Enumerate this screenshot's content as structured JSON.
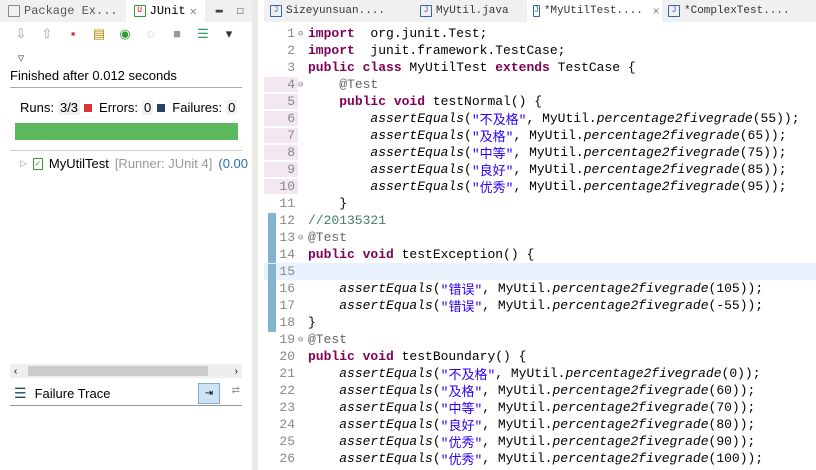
{
  "left": {
    "tabs": [
      {
        "label": "Package Ex..."
      },
      {
        "label": "JUnit"
      }
    ],
    "status": "Finished after 0.012 seconds",
    "runs_label": "Runs:",
    "runs": "3/3",
    "errors_label": "Errors:",
    "errors": "0",
    "failures_label": "Failures:",
    "failures": "0",
    "progress": 1.0,
    "progress_color": "#5cb85c",
    "tree_item": {
      "name": "MyUtilTest",
      "runner": "[Runner: JUnit 4]",
      "time": "(0.00"
    },
    "failure_trace": "Failure Trace"
  },
  "editor": {
    "tabs": [
      {
        "label": "Sizeyunsuan...."
      },
      {
        "label": "MyUtil.java"
      },
      {
        "label": "*MyUtilTest...."
      },
      {
        "label": "*ComplexTest...."
      }
    ],
    "lines": [
      {
        "n": "1",
        "fold": "⊖",
        "t": [
          [
            "kw",
            "import"
          ],
          [
            "",
            "  org.junit.Test;"
          ]
        ]
      },
      {
        "n": "2",
        "t": [
          [
            "kw",
            "import"
          ],
          [
            "",
            "  junit.framework.TestCase;"
          ]
        ]
      },
      {
        "n": "3",
        "t": [
          [
            "kw",
            "public class"
          ],
          [
            "",
            " MyUtilTest "
          ],
          [
            "kw",
            "extends"
          ],
          [
            "",
            " TestCase {"
          ]
        ]
      },
      {
        "n": "4",
        "fold": "⊖",
        "g": "pink",
        "t": [
          [
            "",
            "    "
          ],
          [
            "ann",
            "@Test"
          ]
        ]
      },
      {
        "n": "5",
        "g": "pink",
        "t": [
          [
            "",
            "    "
          ],
          [
            "kw",
            "public void"
          ],
          [
            "",
            " testNormal() {"
          ]
        ]
      },
      {
        "n": "6",
        "g": "pink",
        "t": [
          [
            "",
            "        "
          ],
          [
            "it",
            "assertEquals"
          ],
          [
            "",
            "("
          ],
          [
            "str",
            "\"不及格\""
          ],
          [
            "",
            ", MyUtil."
          ],
          [
            "it",
            "percentage2fivegrade"
          ],
          [
            "",
            "(55));"
          ]
        ]
      },
      {
        "n": "7",
        "g": "pink",
        "t": [
          [
            "",
            "        "
          ],
          [
            "it",
            "assertEquals"
          ],
          [
            "",
            "("
          ],
          [
            "str",
            "\"及格\""
          ],
          [
            "",
            ", MyUtil."
          ],
          [
            "it",
            "percentage2fivegrade"
          ],
          [
            "",
            "(65));"
          ]
        ]
      },
      {
        "n": "8",
        "g": "pink",
        "t": [
          [
            "",
            "        "
          ],
          [
            "it",
            "assertEquals"
          ],
          [
            "",
            "("
          ],
          [
            "str",
            "\"中等\""
          ],
          [
            "",
            ", MyUtil."
          ],
          [
            "it",
            "percentage2fivegrade"
          ],
          [
            "",
            "(75));"
          ]
        ]
      },
      {
        "n": "9",
        "g": "pink",
        "t": [
          [
            "",
            "        "
          ],
          [
            "it",
            "assertEquals"
          ],
          [
            "",
            "("
          ],
          [
            "str",
            "\"良好\""
          ],
          [
            "",
            ", MyUtil."
          ],
          [
            "it",
            "percentage2fivegrade"
          ],
          [
            "",
            "(85));"
          ]
        ]
      },
      {
        "n": "10",
        "g": "pink",
        "t": [
          [
            "",
            "        "
          ],
          [
            "it",
            "assertEquals"
          ],
          [
            "",
            "("
          ],
          [
            "str",
            "\"优秀\""
          ],
          [
            "",
            ", MyUtil."
          ],
          [
            "it",
            "percentage2fivegrade"
          ],
          [
            "",
            "(95));"
          ]
        ]
      },
      {
        "n": "11",
        "t": [
          [
            "",
            "    }"
          ]
        ]
      },
      {
        "n": "12",
        "g": "blue",
        "t": [
          [
            "cm",
            "//20135321"
          ]
        ]
      },
      {
        "n": "13",
        "fold": "⊖",
        "g": "blue",
        "t": [
          [
            "ann",
            "@Test"
          ]
        ]
      },
      {
        "n": "14",
        "g": "blue",
        "t": [
          [
            "kw",
            "public void"
          ],
          [
            "",
            " testException() {"
          ]
        ]
      },
      {
        "n": "15",
        "g": "blue",
        "cur": true,
        "t": [
          [
            "",
            ""
          ]
        ]
      },
      {
        "n": "16",
        "g": "blue",
        "t": [
          [
            "",
            "    "
          ],
          [
            "it",
            "assertEquals"
          ],
          [
            "",
            "("
          ],
          [
            "str",
            "\"错误\""
          ],
          [
            "",
            ", MyUtil."
          ],
          [
            "it",
            "percentage2fivegrade"
          ],
          [
            "",
            "(105));"
          ]
        ]
      },
      {
        "n": "17",
        "g": "blue",
        "t": [
          [
            "",
            "    "
          ],
          [
            "it",
            "assertEquals"
          ],
          [
            "",
            "("
          ],
          [
            "str",
            "\"错误\""
          ],
          [
            "",
            ", MyUtil."
          ],
          [
            "it",
            "percentage2fivegrade"
          ],
          [
            "",
            "(-55));"
          ]
        ]
      },
      {
        "n": "18",
        "g": "blue",
        "t": [
          [
            "",
            "}"
          ]
        ]
      },
      {
        "n": "19",
        "fold": "⊖",
        "t": [
          [
            "ann",
            "@Test"
          ]
        ]
      },
      {
        "n": "20",
        "t": [
          [
            "kw",
            "public void"
          ],
          [
            "",
            " testBoundary() {"
          ]
        ]
      },
      {
        "n": "21",
        "t": [
          [
            "",
            "    "
          ],
          [
            "it",
            "assertEquals"
          ],
          [
            "",
            "("
          ],
          [
            "str",
            "\"不及格\""
          ],
          [
            "",
            ", MyUtil."
          ],
          [
            "it",
            "percentage2fivegrade"
          ],
          [
            "",
            "(0));"
          ]
        ]
      },
      {
        "n": "22",
        "t": [
          [
            "",
            "    "
          ],
          [
            "it",
            "assertEquals"
          ],
          [
            "",
            "("
          ],
          [
            "str",
            "\"及格\""
          ],
          [
            "",
            ", MyUtil."
          ],
          [
            "it",
            "percentage2fivegrade"
          ],
          [
            "",
            "(60));"
          ]
        ]
      },
      {
        "n": "23",
        "t": [
          [
            "",
            "    "
          ],
          [
            "it",
            "assertEquals"
          ],
          [
            "",
            "("
          ],
          [
            "str",
            "\"中等\""
          ],
          [
            "",
            ", MyUtil."
          ],
          [
            "it",
            "percentage2fivegrade"
          ],
          [
            "",
            "(70));"
          ]
        ]
      },
      {
        "n": "24",
        "t": [
          [
            "",
            "    "
          ],
          [
            "it",
            "assertEquals"
          ],
          [
            "",
            "("
          ],
          [
            "str",
            "\"良好\""
          ],
          [
            "",
            ", MyUtil."
          ],
          [
            "it",
            "percentage2fivegrade"
          ],
          [
            "",
            "(80));"
          ]
        ]
      },
      {
        "n": "25",
        "t": [
          [
            "",
            "    "
          ],
          [
            "it",
            "assertEquals"
          ],
          [
            "",
            "("
          ],
          [
            "str",
            "\"优秀\""
          ],
          [
            "",
            ", MyUtil."
          ],
          [
            "it",
            "percentage2fivegrade"
          ],
          [
            "",
            "(90));"
          ]
        ]
      },
      {
        "n": "26",
        "t": [
          [
            "",
            "    "
          ],
          [
            "it",
            "assertEquals"
          ],
          [
            "",
            "("
          ],
          [
            "str",
            "\"优秀\""
          ],
          [
            "",
            ", MyUtil."
          ],
          [
            "it",
            "percentage2fivegrade"
          ],
          [
            "",
            "(100));"
          ]
        ]
      }
    ]
  }
}
